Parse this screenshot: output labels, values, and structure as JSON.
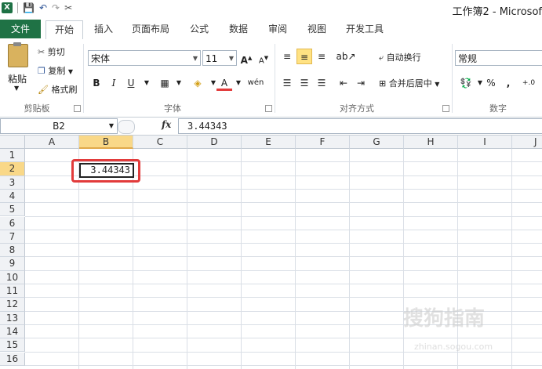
{
  "window": {
    "title": "工作簿2 - Microsof"
  },
  "qat": {
    "excel_icon": "X",
    "save": "💾",
    "undo": "↶",
    "redo": "↷",
    "paint": "✂"
  },
  "tabs": [
    {
      "label": "文件"
    },
    {
      "label": "开始"
    },
    {
      "label": "插入"
    },
    {
      "label": "页面布局"
    },
    {
      "label": "公式"
    },
    {
      "label": "数据"
    },
    {
      "label": "审阅"
    },
    {
      "label": "视图"
    },
    {
      "label": "开发工具"
    }
  ],
  "clipboard": {
    "paste": "粘贴",
    "cut": "剪切",
    "copy": "复制",
    "format_painter": "格式刷",
    "group": "剪贴板"
  },
  "font": {
    "name": "宋体",
    "size": "11",
    "bold": "B",
    "italic": "I",
    "underline": "U",
    "group": "字体"
  },
  "alignment": {
    "wrap": "自动换行",
    "merge": "合并后居中",
    "group": "对齐方式"
  },
  "number": {
    "format": "常规",
    "percent": "%",
    "comma": ",",
    "group": "数字"
  },
  "formula_bar": {
    "name_box": "B2",
    "fx": "fx",
    "value": "3.44343"
  },
  "columns": [
    "A",
    "B",
    "C",
    "D",
    "E",
    "F",
    "G",
    "H",
    "I",
    "J"
  ],
  "rows": [
    "1",
    "2",
    "3",
    "4",
    "5",
    "6",
    "7",
    "8",
    "9",
    "10",
    "11",
    "12",
    "13",
    "14",
    "15",
    "16"
  ],
  "cell_b2": "3.44343",
  "watermark": {
    "main": "搜狗指南",
    "sub": "zhinan.sogou.com"
  }
}
